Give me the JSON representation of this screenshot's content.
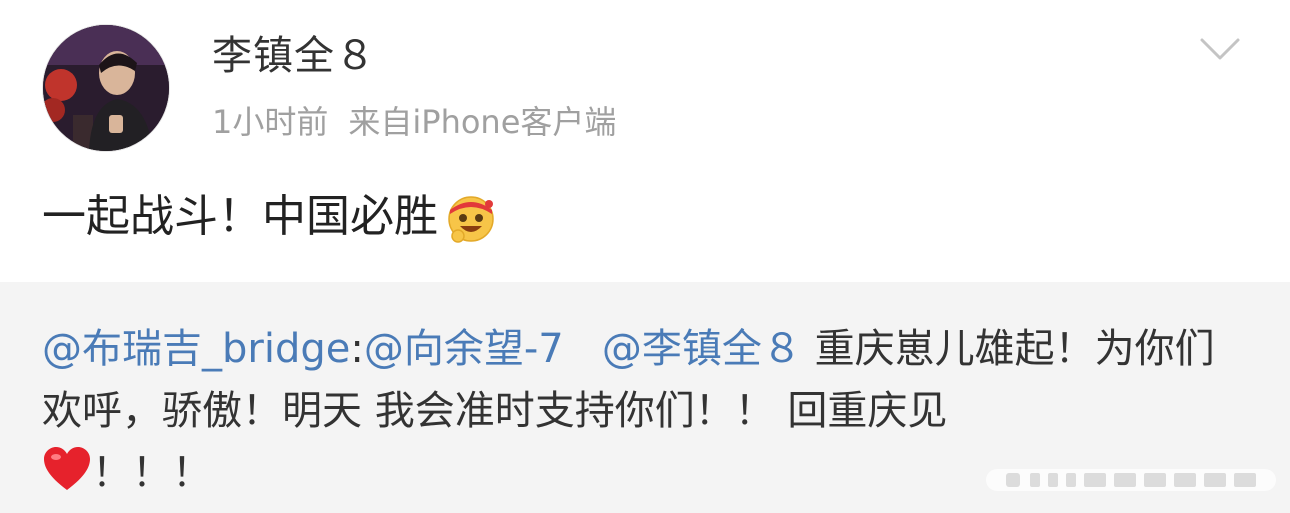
{
  "post": {
    "username": "李镇全８",
    "time": "1小时前",
    "source": "来自iPhone客户端",
    "content": "一起战斗！中国必胜",
    "content_emoji": "grinning-headband-emoji"
  },
  "repost": {
    "mention1": "@布瑞吉_bridge",
    "sep1": ":",
    "mention2": "@向余望-7",
    "mention3": "@李镇全８",
    "text1": " 重庆崽儿雄起！为你们欢呼，骄傲！明天 我会准时支持你们！！ 回重庆见",
    "heart_emoji": "red-heart-emoji",
    "text2": "！！！"
  },
  "icons": {
    "menu": "chevron-down-icon"
  },
  "colors": {
    "mention": "#4a7bb7",
    "meta": "#a0a0a0",
    "repost_bg": "#f4f4f4"
  }
}
